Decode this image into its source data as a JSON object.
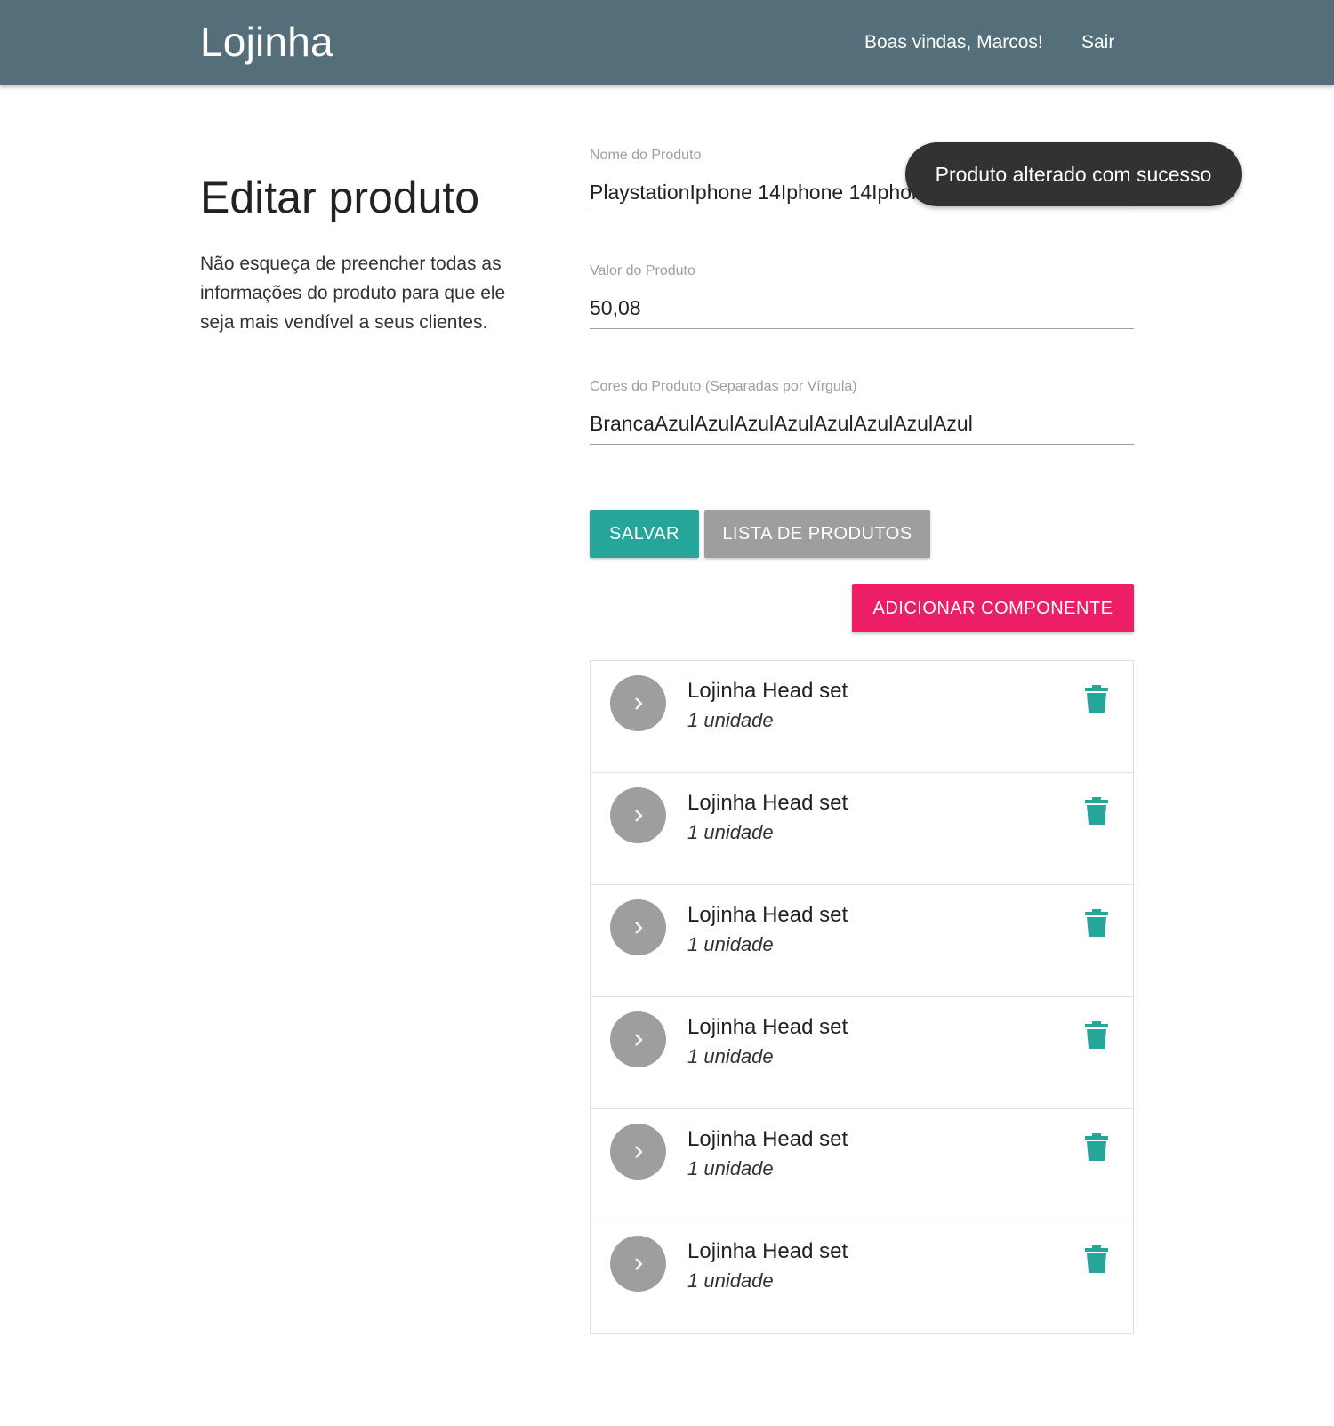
{
  "nav": {
    "brand": "Lojinha",
    "welcome": "Boas vindas, Marcos!",
    "logout": "Sair"
  },
  "page": {
    "title": "Editar produto",
    "description": "Não esqueça de preencher todas as informações do produto para que ele seja mais vendível a seus clientes."
  },
  "form": {
    "nome": {
      "label": "Nome do Produto",
      "value": "PlaystationIphone 14Iphone 14Iphone 14"
    },
    "valor": {
      "label": "Valor do Produto",
      "value": "50,08"
    },
    "cores": {
      "label": "Cores do Produto (Separadas por Vírgula)",
      "value": "BrancaAzulAzulAzulAzulAzulAzulAzulAzul"
    }
  },
  "buttons": {
    "save": "SALVAR",
    "list": "LISTA DE PRODUTOS",
    "add_component": "ADICIONAR COMPONENTE"
  },
  "components": [
    {
      "name": "Lojinha Head set",
      "quantity": "1 unidade"
    },
    {
      "name": "Lojinha Head set",
      "quantity": "1 unidade"
    },
    {
      "name": "Lojinha Head set",
      "quantity": "1 unidade"
    },
    {
      "name": "Lojinha Head set",
      "quantity": "1 unidade"
    },
    {
      "name": "Lojinha Head set",
      "quantity": "1 unidade"
    },
    {
      "name": "Lojinha Head set",
      "quantity": "1 unidade"
    }
  ],
  "toast": {
    "message": "Produto alterado com sucesso"
  },
  "icons": {
    "item_expand": "chevron-right-icon",
    "item_delete": "trash-icon"
  },
  "colors": {
    "navbar": "#546e7a",
    "save_button": "#26a69a",
    "list_button": "#9e9e9e",
    "add_button": "#ec1e66",
    "trash_icon": "#26a69a",
    "toast": "#323232"
  }
}
